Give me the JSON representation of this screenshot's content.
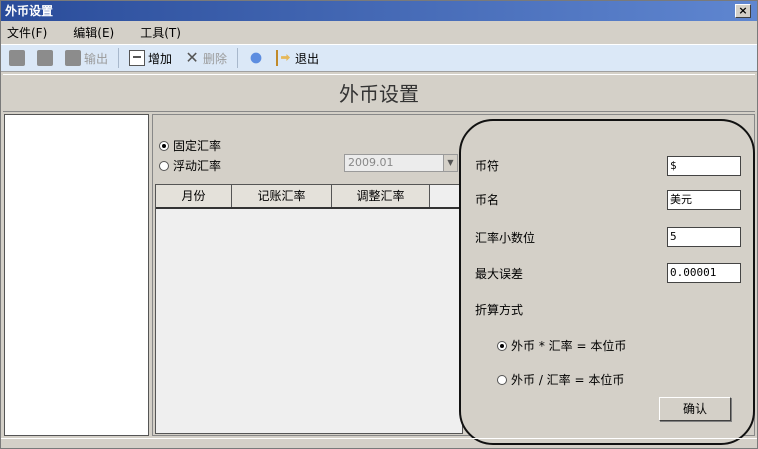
{
  "window": {
    "title": "外币设置",
    "close_label": "×"
  },
  "menu": {
    "items": [
      "文件(F)",
      "编辑(E)",
      "工具(T)"
    ]
  },
  "toolbar": {
    "export_label": "输出",
    "add_label": "增加",
    "delete_label": "删除",
    "exit_label": "退出"
  },
  "header": {
    "title": "外币设置"
  },
  "rate_mode": {
    "options": [
      "固定汇率",
      "浮动汇率"
    ],
    "selected": "固定汇率",
    "period_value": "2009.01"
  },
  "grid": {
    "columns": [
      "月份",
      "记账汇率",
      "调整汇率"
    ]
  },
  "settings": {
    "symbol_label": "币符",
    "symbol_value": "$",
    "name_label": "币名",
    "name_value": "美元",
    "decimals_label": "汇率小数位",
    "decimals_value": "5",
    "max_error_label": "最大误差",
    "max_error_value": "0.00001",
    "method_label": "折算方式",
    "method_options": [
      "外币 * 汇率 = 本位币",
      "外币 / 汇率 = 本位币"
    ],
    "method_selected": "外币 * 汇率 = 本位币",
    "confirm_label": "确认"
  }
}
